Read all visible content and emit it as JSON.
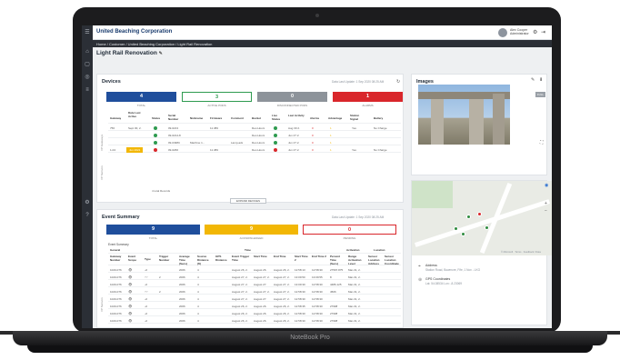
{
  "device_label": "NoteBook Pro",
  "app": {
    "title": "United Beaching Corporation",
    "user_name": "Alex Cooper",
    "user_role": "Administrator"
  },
  "breadcrumb": "Home / Customer / United Beaching Corporation / Light Rail Renovation",
  "page_title": "Light Rail Renovation",
  "devices": {
    "title": "Devices",
    "updated": "Data Last Update: 1 Sep 2020 08:25 AM",
    "tiles": [
      {
        "value": "4",
        "label": "TOTAL"
      },
      {
        "value": "3",
        "label": "ACTIVE PODS"
      },
      {
        "value": "0",
        "label": "DISCONNECTED PODS"
      },
      {
        "value": "1",
        "label": "ALARMS"
      }
    ],
    "headers": [
      "Gateway",
      "Date Last Active",
      "Status",
      "Serial Number",
      "Nickname",
      "Firmware",
      "Comment",
      "Bucket",
      "Live Status",
      "Last Activity",
      "Alarms",
      "Advantage",
      "Station Signal",
      "Battery"
    ],
    "rows": [
      {
        "gateway": "756",
        "date": "Sept 30, 2.",
        "status": "ok",
        "serial": "09-0213",
        "nick": "",
        "firmware": "11.383",
        "comment": "",
        "bucket": "Dec-Hours",
        "live": "ok",
        "last": "Aug 30 2.",
        "alarms": "0",
        "adv": "1",
        "signal": "Yes",
        "battery": "No Charge"
      },
      {
        "gateway": "",
        "date": "",
        "status": "ok",
        "serial": "09-0214-8",
        "nick": "",
        "firmware": "",
        "comment": "",
        "bucket": "Dec-Hours",
        "live": "ok",
        "last": "Jun 27 2.",
        "alarms": "0",
        "adv": "1",
        "signal": "",
        "battery": ""
      },
      {
        "gateway": "",
        "date": "",
        "status": "ok",
        "serial": "09-0498C",
        "nick": "Machine 1...",
        "firmware": "",
        "comment": "Lamp-ads",
        "bucket": "Dec-Hours",
        "live": "ok",
        "last": "Jun 27 2.",
        "alarms": "0",
        "adv": "1",
        "signal": "",
        "battery": ""
      },
      {
        "gateway": "1-04",
        "date": "Jun 2021",
        "status": "alarm",
        "serial": "09-0266",
        "nick": "",
        "firmware": "11.383",
        "comment": "",
        "bucket": "Dec-Hours",
        "live": "alarm",
        "last": "Jun 27 2.",
        "alarms": "0",
        "adv": "1",
        "signal": "Yes",
        "battery": "No Charge"
      }
    ],
    "footer_text": "4 total Records",
    "expand_label": "EXPAND DEVICES",
    "side_label_1": "VP Gateways",
    "side_label_2": "VP Sensors"
  },
  "images": {
    "title": "Images",
    "zoom_label": "FULL"
  },
  "map": {
    "attribution": "© Microsoft · Terms · Feedback / Data",
    "address_label": "Address",
    "address_value": "Station Road, Bowmore, Fife, 1 Nov - LKG",
    "gps_label": "GPS Coordinates",
    "gps_value": "Lat: 54.08534  Lon: -8.23069"
  },
  "events": {
    "title": "Event Summary",
    "updated": "Data Last Update: 1 Sep 2020 08:25 AM",
    "tiles": [
      {
        "value": "9",
        "label": "TOTAL"
      },
      {
        "value": "9",
        "label": "ACKNOWLEDGED"
      },
      {
        "value": "0",
        "label": "PENDING"
      }
    ],
    "section_label": "Event Summary",
    "group_headers": [
      "General",
      "Time",
      "Activation",
      "Location"
    ],
    "headers": [
      "Gateway Number",
      "Event Scope",
      "Type",
      "Trigger Number",
      "Average Time (Secs)",
      "Source Distance (ft)",
      "GPS Distance",
      "Event Trigger Time",
      "Start Time",
      "End Time",
      "Start Time 2",
      "End Time 2",
      "Percent Time (Secs)",
      "Range Activation Level",
      "Sensor Location Address",
      "Sensor Location Coordinate"
    ],
    "rows": [
      [
        "1020-076",
        "eye",
        "sig",
        "",
        "2006",
        "4",
        "",
        "August 26, 2.",
        "August 26.",
        "August 26, 2.",
        "12:58:13",
        "12:58:30",
        "27597.875",
        "Mar-31, 2.",
        ""
      ],
      [
        "1020-076",
        "eye",
        "wave",
        "2",
        "2006",
        "4",
        "",
        "August 27, 2.",
        "August 27, 2.",
        "August 27, 2.",
        "13:09:50",
        "13:09:55",
        "8",
        "Mar-31, 2.",
        ""
      ],
      [
        "1020-076",
        "eye",
        "sig",
        "",
        "2006",
        "4",
        "",
        "August 27, 2.",
        "August 27.",
        "August 27, 2.",
        "13:09:30",
        "12:58:30",
        "4486.125",
        "Mar-31, 2.",
        ""
      ],
      [
        "1020-076",
        "eye",
        "wave",
        "2",
        "2006",
        "4",
        "",
        "August 27, 2.",
        "August 27, 2.",
        "August 27, 2.",
        "12:58:30",
        "12:58:30",
        "4506",
        "Mar-31, 2.",
        ""
      ],
      [
        "1020-076",
        "eye",
        "sig",
        "",
        "2006",
        "4",
        "",
        "August 27, 2.",
        "August 27.",
        "August 27, 2.",
        "12:58:30",
        "12:58:30",
        "",
        "Mar-31, 2.",
        ""
      ],
      [
        "1020-076",
        "eye",
        "sig",
        "",
        "2006",
        "4",
        "",
        "August 26, 2.",
        "August 26.",
        "August 26, 2.",
        "12:58:35",
        "12:58:30",
        "27998",
        "Mar-31, 2.",
        ""
      ],
      [
        "1020-076",
        "eye",
        "sig",
        "",
        "2006",
        "4",
        "",
        "August 26, 2.",
        "August 26.",
        "August 26, 2.",
        "12:58:30",
        "12:58:30",
        "27998",
        "Mar-31, 2.",
        ""
      ],
      [
        "1020-076",
        "eye",
        "sig",
        "",
        "2006",
        "4",
        "",
        "August 26, 2.",
        "August 26.",
        "August 26, 2.",
        "12:58:30",
        "12:58:30",
        "27998",
        "Mar-31, 2.",
        ""
      ]
    ],
    "side_label": "VP Sensors"
  },
  "colors": {
    "blue": "#1f4e9c",
    "green": "#2e9a4f",
    "gray": "#8d939a",
    "red": "#d9262b",
    "yellow": "#f2b705"
  }
}
